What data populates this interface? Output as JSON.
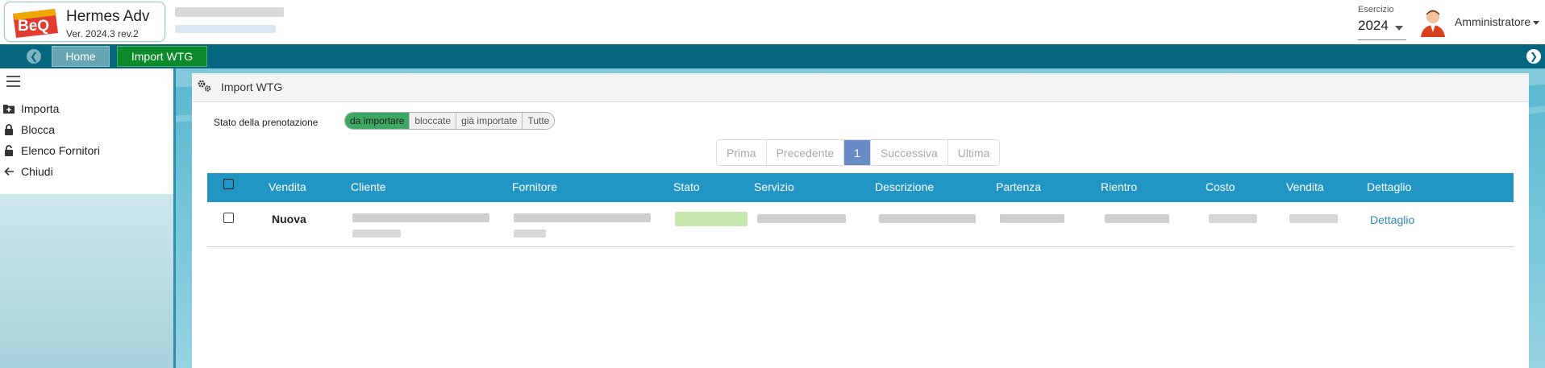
{
  "app": {
    "title": "Hermes Adv",
    "version": "Ver. 2024.3 rev.2",
    "logo_text": "BeQ"
  },
  "header": {
    "esercizio_label": "Esercizio",
    "esercizio_value": "2024",
    "user_name": "Amministratore"
  },
  "tabs": [
    {
      "label": "Home"
    },
    {
      "label": "Import WTG"
    }
  ],
  "sidebar": {
    "items": [
      {
        "label": "Importa",
        "icon": "folder-plus-icon"
      },
      {
        "label": "Blocca",
        "icon": "lock-icon"
      },
      {
        "label": "Elenco Fornitori",
        "icon": "unlock-icon"
      },
      {
        "label": "Chiudi",
        "icon": "arrow-left-icon"
      }
    ]
  },
  "panel": {
    "title": "Import WTG"
  },
  "filter": {
    "label": "Stato della prenotazione",
    "options": [
      "da importare",
      "bloccate",
      "già importate",
      "Tutte"
    ],
    "selected": "da importare"
  },
  "pager": {
    "first": "Prima",
    "prev": "Precedente",
    "current": "1",
    "next": "Successiva",
    "last": "Ultima"
  },
  "table": {
    "columns": [
      "Vendita",
      "Cliente",
      "Fornitore",
      "Stato",
      "Servizio",
      "Descrizione",
      "Partenza",
      "Rientro",
      "Costo",
      "Vendita",
      "Dettaglio"
    ],
    "rows": [
      {
        "vendita": "Nuova",
        "dettaglio": "Dettaglio"
      }
    ]
  },
  "colors": {
    "tabbar": "#05677f",
    "table_header": "#2196c4",
    "active_filter": "#3ca864",
    "active_page": "#6a8cc6",
    "import_tab": "#0a8a2a"
  }
}
